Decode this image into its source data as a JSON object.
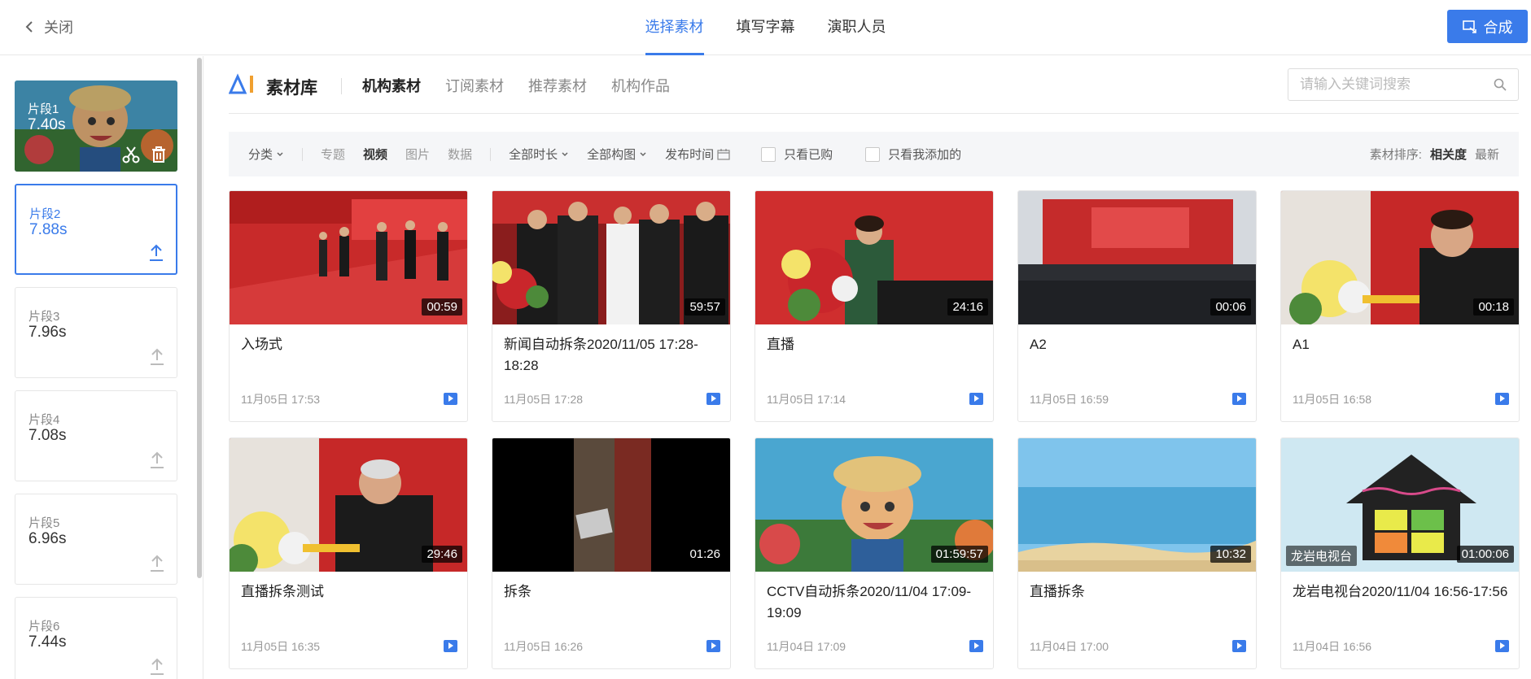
{
  "header": {
    "close_label": "关闭",
    "tabs": [
      {
        "label": "选择素材",
        "active": true
      },
      {
        "label": "填写字幕",
        "active": false
      },
      {
        "label": "演职人员",
        "active": false
      }
    ],
    "compose_label": "合成",
    "accent_color": "#3a7bea"
  },
  "sidebar": {
    "segments": [
      {
        "label": "片段1",
        "duration": "7.40s"
      },
      {
        "label": "片段2",
        "duration": "7.88s"
      },
      {
        "label": "片段3",
        "duration": "7.96s"
      },
      {
        "label": "片段4",
        "duration": "7.08s"
      },
      {
        "label": "片段5",
        "duration": "6.96s"
      },
      {
        "label": "片段6",
        "duration": "7.44s"
      }
    ]
  },
  "library": {
    "title": "素材库",
    "tabs": [
      {
        "label": "机构素材",
        "active": true
      },
      {
        "label": "订阅素材",
        "active": false
      },
      {
        "label": "推荐素材",
        "active": false
      },
      {
        "label": "机构作品",
        "active": false
      }
    ],
    "search_placeholder": "请输入关键词搜索"
  },
  "filters": {
    "category": "分类",
    "types": [
      "专题",
      "视频",
      "图片",
      "数据"
    ],
    "duration": "全部时长",
    "composition": "全部构图",
    "publish_time": "发布时间",
    "only_purchased": "只看已购",
    "only_mine": "只看我添加的",
    "sort_label": "素材排序:",
    "sort_relevance": "相关度",
    "sort_latest": "最新"
  },
  "cards": [
    {
      "title": "入场式",
      "duration": "00:59",
      "date": "11月05日 17:53"
    },
    {
      "title": "新闻自动拆条2020/11/05 17:28-18:28",
      "duration": "59:57",
      "date": "11月05日 17:28"
    },
    {
      "title": "直播",
      "duration": "24:16",
      "date": "11月05日 17:14"
    },
    {
      "title": "A2",
      "duration": "00:06",
      "date": "11月05日 16:59"
    },
    {
      "title": "A1",
      "duration": "00:18",
      "date": "11月05日 16:58"
    },
    {
      "title": "直播拆条测试",
      "duration": "29:46",
      "date": "11月05日 16:35"
    },
    {
      "title": "拆条",
      "duration": "01:26",
      "date": "11月05日 16:26"
    },
    {
      "title": "CCTV自动拆条2020/11/04 17:09-19:09",
      "duration": "01:59:57",
      "date": "11月04日 17:09"
    },
    {
      "title": "直播拆条",
      "duration": "10:32",
      "date": "11月04日 17:00"
    },
    {
      "title": "龙岩电视台2020/11/04 16:56-17:56",
      "duration": "01:00:06",
      "date": "11月04日 16:56",
      "overlay": "龙岩电视台"
    }
  ]
}
